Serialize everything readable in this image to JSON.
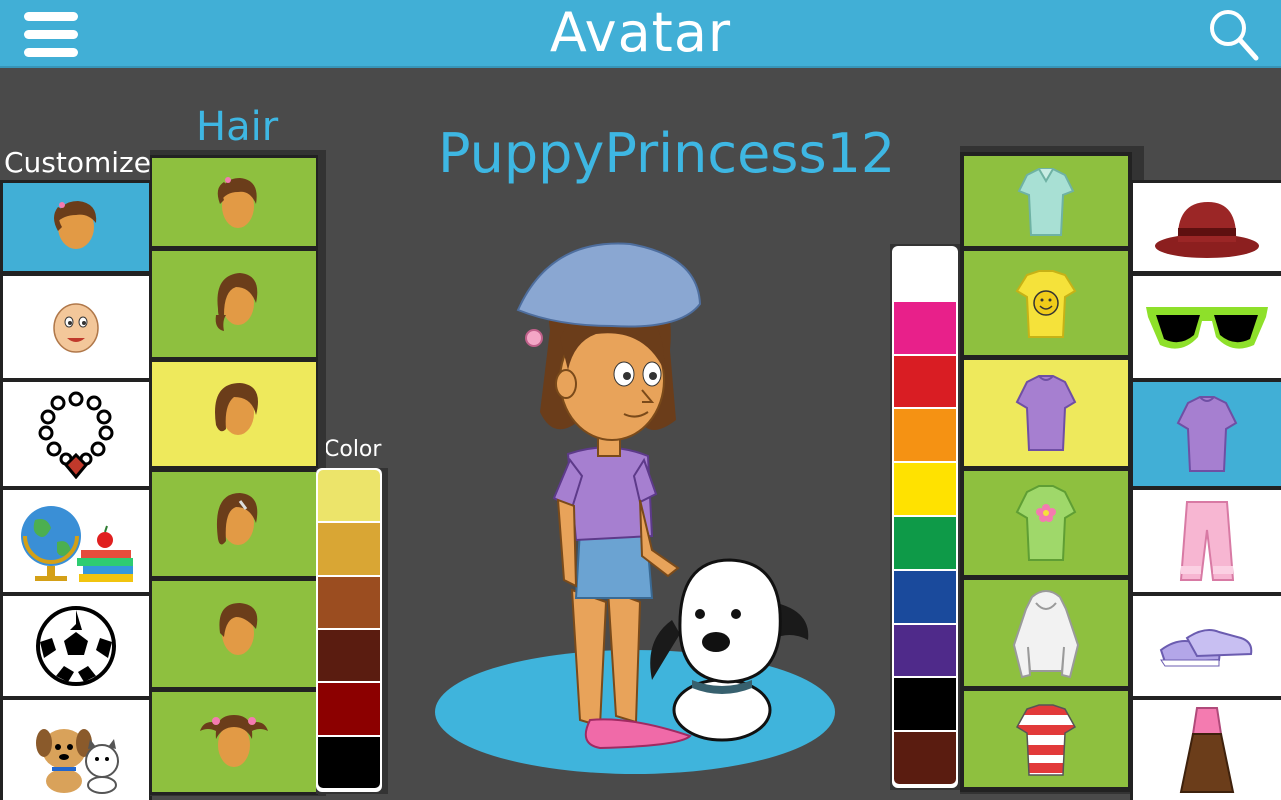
{
  "header": {
    "title": "Avatar",
    "menu_icon": "hamburger-menu-icon",
    "search_icon": "search-icon",
    "background": "#41afd6"
  },
  "labels": {
    "customize": "Customize",
    "hair": "Hair",
    "color": "Color",
    "username": "PuppyPrincess12"
  },
  "customize_categories": [
    {
      "name": "hair",
      "icon": "hair-icon",
      "selected": true
    },
    {
      "name": "face",
      "icon": "face-icon",
      "selected": false
    },
    {
      "name": "necklace",
      "icon": "necklace-icon",
      "selected": false
    },
    {
      "name": "school",
      "icon": "globe-books-icon",
      "selected": false
    },
    {
      "name": "sports",
      "icon": "soccer-ball-icon",
      "selected": false
    },
    {
      "name": "pets",
      "icon": "pets-icon",
      "selected": false
    }
  ],
  "hair_styles": [
    {
      "name": "ponytail",
      "selected": false
    },
    {
      "name": "shoulder-length",
      "selected": false
    },
    {
      "name": "bob",
      "selected": true
    },
    {
      "name": "with-clip",
      "selected": false
    },
    {
      "name": "short",
      "selected": false
    },
    {
      "name": "pigtails",
      "selected": false
    }
  ],
  "hair_colors": [
    "#ece46a",
    "#d9a634",
    "#9b4d20",
    "#5a1c10",
    "#8c0000",
    "#000000"
  ],
  "clothing_colors": [
    "#ffffff",
    "#e8208a",
    "#d91d23",
    "#f59213",
    "#ffe200",
    "#0e9a48",
    "#1a4a9c",
    "#4f2a8a",
    "#000000",
    "#5a1c10"
  ],
  "tops": [
    {
      "name": "polo-shirt",
      "color": "#a8e0d4",
      "selected": false
    },
    {
      "name": "smiley-tee",
      "color": "#f5e23a",
      "selected": false
    },
    {
      "name": "purple-tee",
      "color": "#a67fd0",
      "selected": true
    },
    {
      "name": "flower-tee",
      "color": "#8ccf5c",
      "selected": false
    },
    {
      "name": "hoodie",
      "color": "#f2f2f2",
      "selected": false
    },
    {
      "name": "striped-tee",
      "color": "#e23a3a",
      "selected": false
    }
  ],
  "wardrobe_categories": [
    {
      "name": "hats",
      "icon": "hat-icon",
      "selected": false
    },
    {
      "name": "glasses",
      "icon": "sunglasses-icon",
      "selected": false
    },
    {
      "name": "tops",
      "icon": "shirt-icon",
      "selected": true
    },
    {
      "name": "bottoms",
      "icon": "pants-icon",
      "selected": false
    },
    {
      "name": "shoes",
      "icon": "sneakers-icon",
      "selected": false
    },
    {
      "name": "dresses",
      "icon": "dress-icon",
      "selected": false
    }
  ],
  "colors": {
    "accent_blue": "#3eb7e3",
    "tile_green": "#8ec03f",
    "tile_yellow": "#eee95c",
    "platform": "#3fb4dc"
  }
}
